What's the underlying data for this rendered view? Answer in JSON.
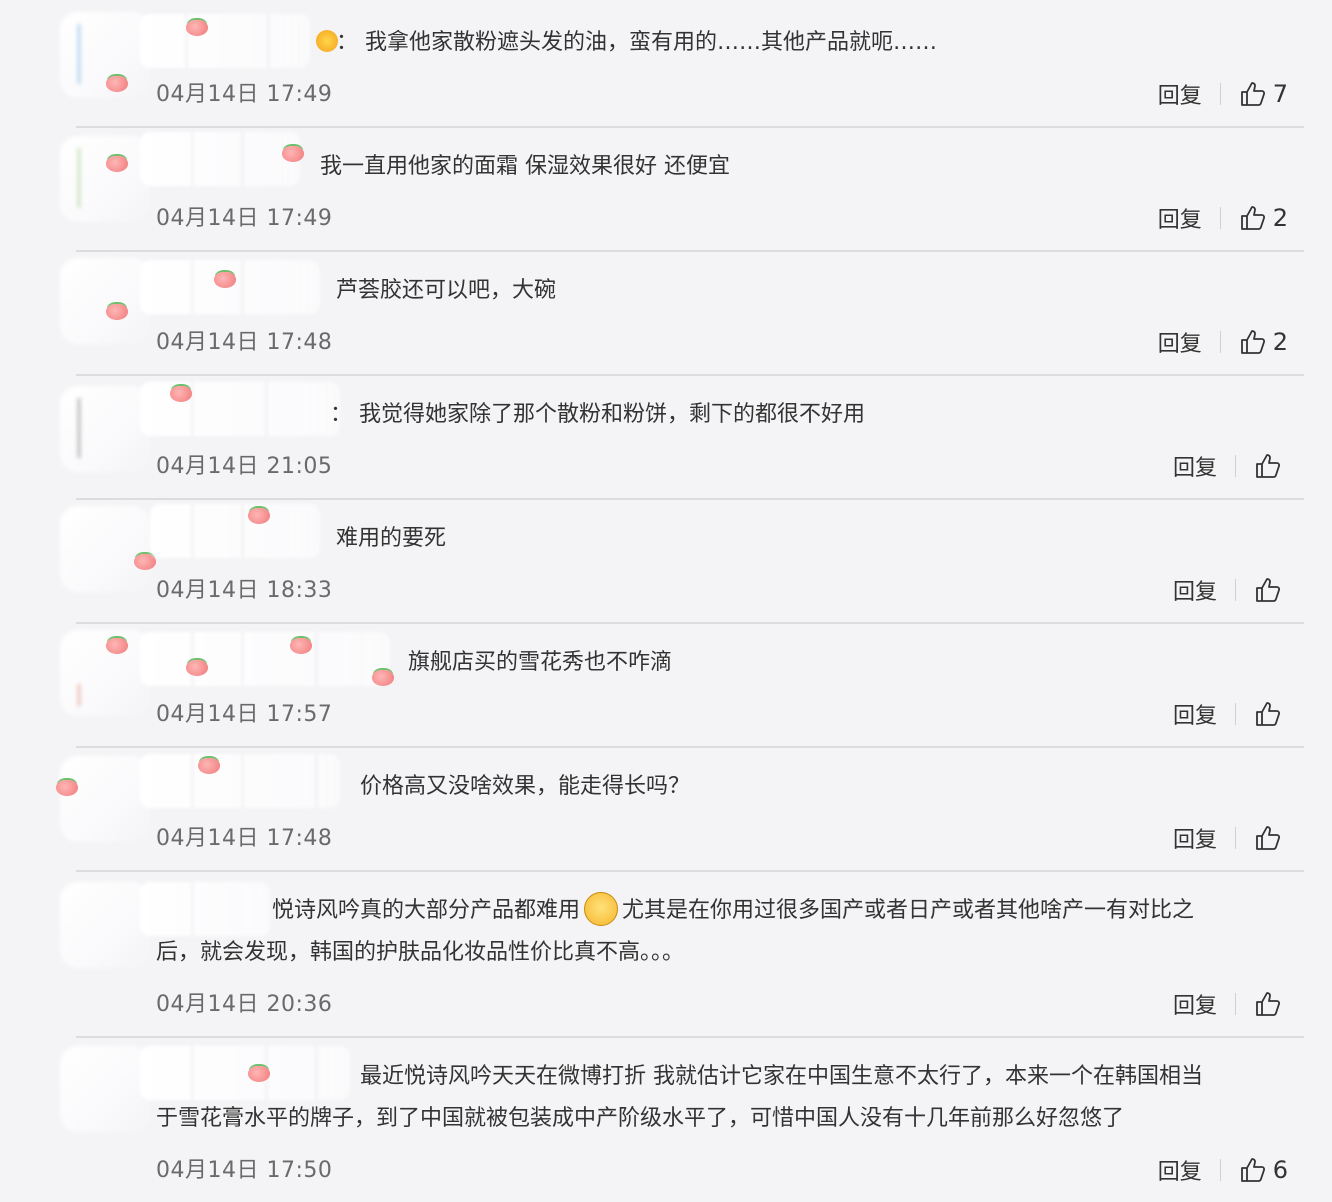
{
  "comments": [
    {
      "text": "我拿他家散粉遮头发的油，蛮有用的……其他产品就呃……",
      "prefix": "：",
      "time": "04月14日 17:49",
      "reply": "回复",
      "likes": "7"
    },
    {
      "text": "我一直用他家的面霜 保湿效果很好 还便宜",
      "prefix": "",
      "time": "04月14日 17:49",
      "reply": "回复",
      "likes": "2"
    },
    {
      "text": "芦荟胶还可以吧，大碗",
      "prefix": "",
      "time": "04月14日 17:48",
      "reply": "回复",
      "likes": "2"
    },
    {
      "text": "我觉得她家除了那个散粉和粉饼，剩下的都很不好用",
      "prefix": "：",
      "time": "04月14日 21:05",
      "reply": "回复",
      "likes": ""
    },
    {
      "text": "难用的要死",
      "prefix": "",
      "time": "04月14日 18:33",
      "reply": "回复",
      "likes": ""
    },
    {
      "text": "旗舰店买的雪花秀也不咋滴",
      "prefix": "",
      "time": "04月14日 17:57",
      "reply": "回复",
      "likes": ""
    },
    {
      "text": "价格高又没啥效果，能走得长吗？",
      "prefix": "",
      "time": "04月14日 17:48",
      "reply": "回复",
      "likes": ""
    },
    {
      "text_a": "悦诗风吟真的大部分产品都难用",
      "text_b": "尤其是在你用过很多国产或者日产或者其他啥产一有对比之",
      "text_c": "后，就会发现，韩国的护肤品化妆品性价比真不高。。。",
      "time": "04月14日 20:36",
      "reply": "回复",
      "likes": ""
    },
    {
      "text_a": "最近悦诗风吟天天在微博打折 我就估计它家在中国生意不太行了，本来一个在韩国相当",
      "text_c": "于雪花膏水平的牌子，到了中国就被包装成中产阶级水平了，可惜中国人没有十几年前那么好忽悠了",
      "time": "04月14日 17:50",
      "reply": "回复",
      "likes": "6"
    }
  ],
  "icons": {
    "like": "thumbs-up-icon",
    "vip": "crown-icon",
    "emoji": "smiling-face-icon",
    "badge": "strawberry-icon"
  },
  "colors": {
    "background": "#f4f4f6",
    "text": "#333333",
    "time": "#6a6a6a",
    "divider": "#dcdce0"
  }
}
